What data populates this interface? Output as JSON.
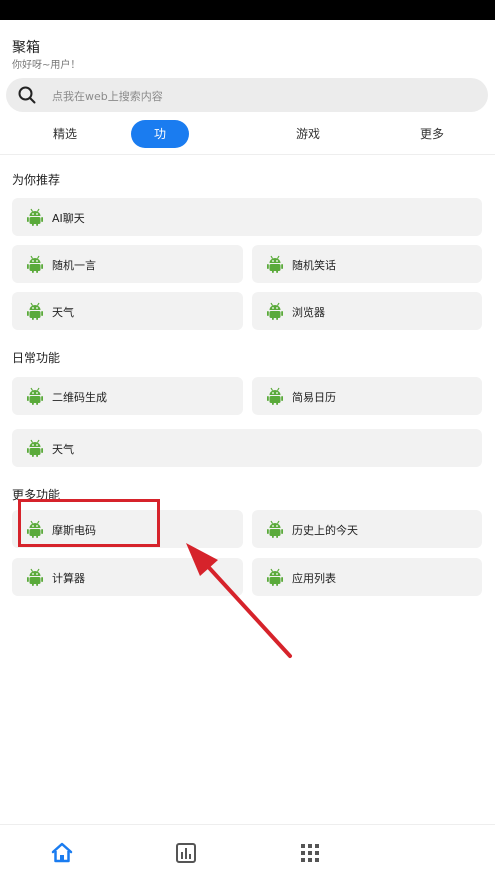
{
  "header": {
    "title": "聚箱",
    "subtitle": "你好呀~用户！"
  },
  "search": {
    "placeholder": "点我在web上搜索内容"
  },
  "tabs": [
    {
      "label": "精选"
    },
    {
      "label": "功"
    },
    {
      "label": "游戏"
    },
    {
      "label": "更多"
    }
  ],
  "sections": {
    "recommend": {
      "title": "为你推荐",
      "items": [
        "AI聊天",
        "随机一言",
        "随机笑话",
        "天气",
        "浏览器"
      ]
    },
    "daily": {
      "title": "日常功能",
      "items": [
        "二维码生成",
        "简易日历",
        "天气"
      ]
    },
    "more": {
      "title": "更多功能",
      "items": [
        "摩斯电码",
        "历史上的今天",
        "计算器",
        "应用列表"
      ]
    }
  },
  "colors": {
    "accent": "#1a7cf0",
    "icon_green": "#5aaa3a",
    "annotation_red": "#d6232b"
  },
  "icons": {
    "card": "android-icon",
    "search": "search-icon",
    "nav": [
      "home-icon",
      "chart-icon",
      "grid-icon"
    ]
  }
}
